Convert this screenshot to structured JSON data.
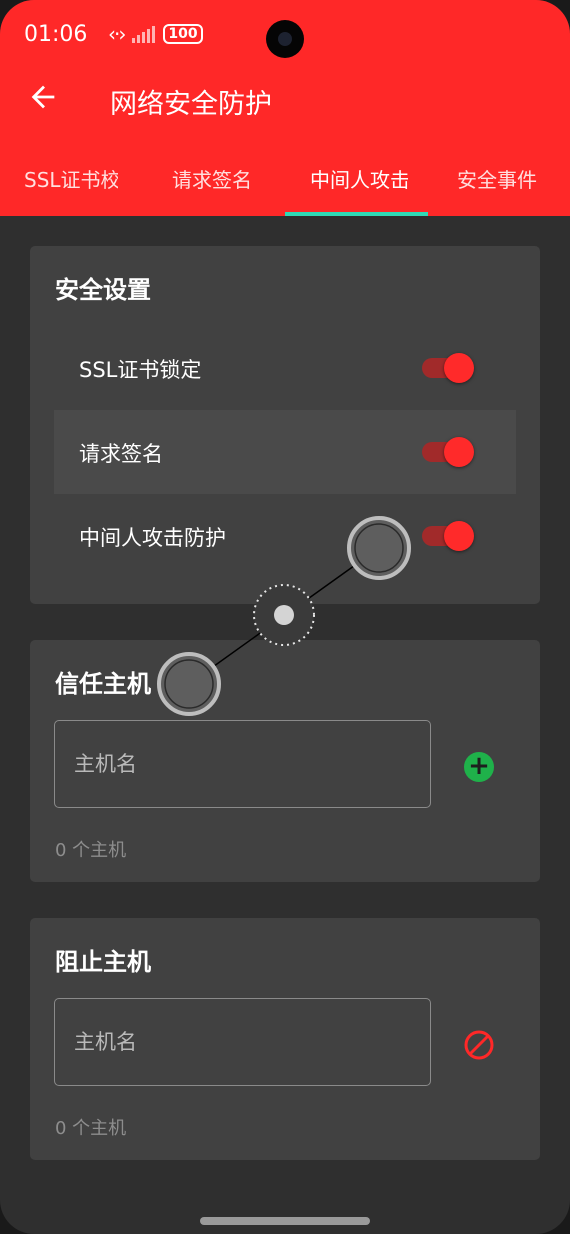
{
  "status_bar": {
    "time": "01:06",
    "battery": "100"
  },
  "app_bar": {
    "title": "网络安全防护"
  },
  "tabs": [
    {
      "label": "SSL证书校验",
      "selected": false
    },
    {
      "label": "请求签名",
      "selected": false
    },
    {
      "label": "中间人攻击防护",
      "selected": true
    },
    {
      "label": "安全事件",
      "selected": false
    }
  ],
  "security_settings": {
    "title": "安全设置",
    "items": [
      {
        "label": "SSL证书锁定",
        "enabled": true
      },
      {
        "label": "请求签名",
        "enabled": true
      },
      {
        "label": "中间人攻击防护",
        "enabled": true
      }
    ]
  },
  "trusted_hosts": {
    "title": "信任主机",
    "input_placeholder": "主机名",
    "count_text": "0 个主机"
  },
  "blocked_hosts": {
    "title": "阻止主机",
    "input_placeholder": "主机名",
    "count_text": "0 个主机"
  },
  "colors": {
    "accent": "#ff2828",
    "tab_indicator": "#2fd9b6",
    "add_button": "#1fb14a",
    "card": "#414141",
    "background": "#2f2f2f"
  },
  "icons": {
    "back": "arrow-left-icon",
    "add": "plus-circle-icon",
    "block": "ban-icon"
  }
}
